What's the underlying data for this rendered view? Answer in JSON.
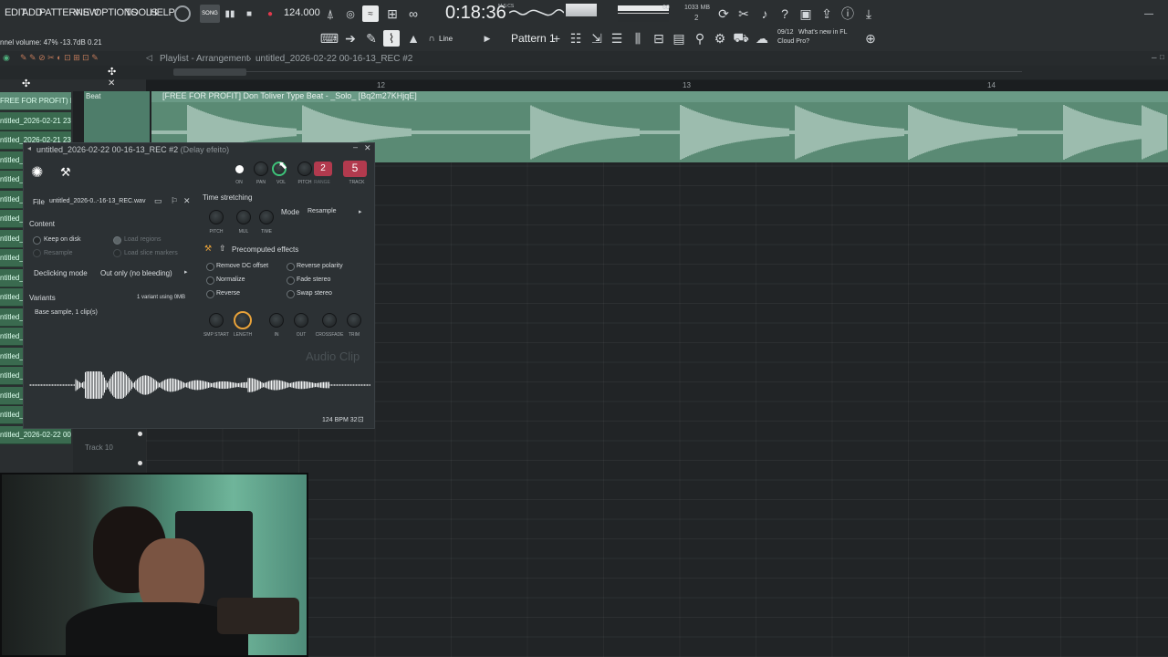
{
  "menu": [
    "EDIT",
    "ADD",
    "PATTERNS",
    "VIEW",
    "OPTIONS",
    "TOOLS",
    "HELP"
  ],
  "transport": {
    "mode": "SONG",
    "tempo": "124.000",
    "time": "0:18:36",
    "time_unit": "M:S:CS",
    "cpu": "60",
    "memory": "1033 MB",
    "polyphony": "2"
  },
  "hint": "nnel volume: 47%  -13.7dB  0.21",
  "toolbar2": {
    "snap": "Line",
    "pattern": "Pattern 1",
    "news_date": "09/12",
    "news_text_1": "What's new in FL",
    "news_text_2": "Cloud Pro?"
  },
  "playlist": {
    "breadcrumb_1": "Playlist - Arrangement",
    "breadcrumb_2": "untitled_2026-02-22 00-16-13_REC #2",
    "ruler": [
      "12",
      "13",
      "14"
    ]
  },
  "tracks": [
    "FREE FOR PROFIT) D",
    "ntitled_2026-02-21 23-",
    "ntitled_2026-02-21 23-",
    "ntitled_20",
    "ntitled_20",
    "ntitled_20",
    "ntitled_20",
    "ntitled_20",
    "ntitled_20",
    "ntitled_20",
    "ntitled_20",
    "ntitled_20",
    "ntitled_20",
    "ntitled_20",
    "ntitled_20",
    "ntitled_20",
    "ntitled_2026-02-22 00-",
    "ntitled_2026-02-22 00-"
  ],
  "clip": {
    "beat_label": "Beat",
    "title": "[FREE FOR PROFIT] Don Toliver Type Beat - _Solo_ [Bq2m27KHjqE]"
  },
  "track10": "Track 10",
  "window": {
    "title": "untitled_2026-02-22 00-16-13_REC #2",
    "title_sub": "(Delay efeito)",
    "file_label": "File",
    "file_name": "untitled_2026-0..-16-13_REC.wav",
    "content": "Content",
    "keep_on_disk": "Keep on disk",
    "resample": "Resample",
    "load_regions": "Load regions",
    "load_slice": "Load slice markers",
    "declick_label": "Declicking mode",
    "declick_value": "Out only (no bleeding)",
    "variants": "Variants",
    "variants_value": "1 variant using 0MB",
    "base_sample": "Base sample, 1 clip(s)",
    "knobs_top": [
      "ON",
      "PAN",
      "VOL",
      "PITCH",
      "RANGE",
      "TRACK"
    ],
    "range_value": "2",
    "track_value": "5",
    "time_stretching": "Time stretching",
    "ts_knobs": [
      "PITCH",
      "MUL",
      "TIME"
    ],
    "mode_label": "Mode",
    "mode_value": "Resample",
    "precomputed": "Precomputed effects",
    "effects": [
      "Remove DC offset",
      "Reverse polarity",
      "Normalize",
      "Fade stereo",
      "Reverse",
      "Swap stereo"
    ],
    "bottom_knobs": [
      "SMP START",
      "LENGTH",
      "IN",
      "OUT",
      "CROSSFADE",
      "TRIM"
    ],
    "watermark": "Audio Clip",
    "bpm": "124 BPM 32"
  },
  "colors": {
    "clip": "#5a8a74",
    "track": "#3a6a4f",
    "accent": "#e8a23a",
    "red": "#b23a4e",
    "green": "#3ec47a"
  }
}
